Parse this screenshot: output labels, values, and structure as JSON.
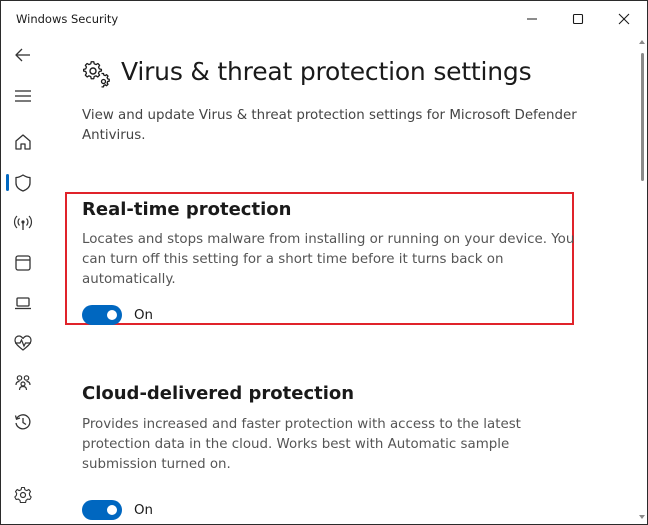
{
  "window": {
    "title": "Windows Security",
    "controls": [
      "minimize-icon",
      "maximize-icon",
      "close-icon"
    ]
  },
  "rail": {
    "items": [
      {
        "icon": "back-arrow-icon"
      },
      {
        "icon": "hamburger-menu-icon"
      },
      {
        "icon": "home-icon"
      },
      {
        "icon": "shield-icon",
        "active": true
      },
      {
        "icon": "wireless-antenna-icon"
      },
      {
        "icon": "app-browser-icon"
      },
      {
        "icon": "laptop-icon"
      },
      {
        "icon": "heart-pulse-icon"
      },
      {
        "icon": "family-icon"
      },
      {
        "icon": "history-icon"
      },
      {
        "icon": "settings-gear-icon"
      }
    ],
    "accent": "#0067c0"
  },
  "main": {
    "title": "Virus & threat protection settings",
    "title_icon": "gears-icon",
    "description": "View and update Virus & threat protection settings for Microsoft Defender Antivirus.",
    "sections": [
      {
        "title": "Real-time protection",
        "description": "Locates and stops malware from installing or running on your device. You can turn off this setting for a short time before it turns back on automatically.",
        "toggle_state": "On",
        "enabled": true,
        "highlighted": true,
        "highlight_color": "#e0232a"
      },
      {
        "title": "Cloud-delivered protection",
        "description": "Provides increased and faster protection with access to the latest protection data in the cloud. Works best with Automatic sample submission turned on.",
        "toggle_state": "On",
        "enabled": true,
        "highlighted": false
      }
    ]
  },
  "colors": {
    "toggle_on": "#0067c0",
    "text_primary": "#1a1a1a",
    "text_secondary": "#555555"
  }
}
